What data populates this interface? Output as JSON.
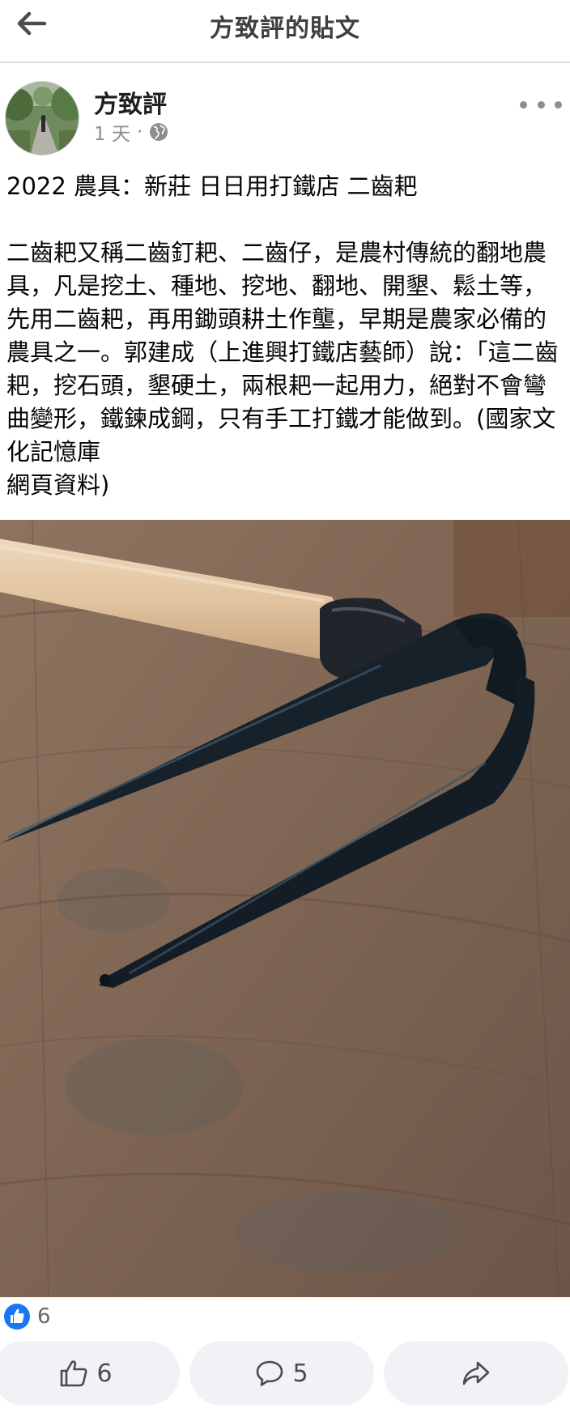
{
  "header": {
    "title": "方致評的貼文",
    "back_icon": "arrow-left-icon"
  },
  "post": {
    "author": "方致評",
    "time": "1 天",
    "separator": "·",
    "privacy_icon": "globe-icon",
    "title_line": "2022 農具：新莊 日日用打鐵店 二齒耙",
    "body": "二齒耙又稱二齒釘耙、二齒仔，是農村傳統的翻地農具，凡是挖土、種地、挖地、翻地、開墾、鬆土等，先用二齒耙，再用鋤頭耕土作壟，早期是農家必備的農具之一。郭建成（上進興打鐵店藝師）說：「這二齒耙，挖石頭，墾硬土，兩根耙一起用力，絕對不會彎曲變形，鐵鍊成鋼，只有手工打鐵才能做到。(國家文化記憶庫\n網頁資料)"
  },
  "reactions": {
    "count": "6",
    "icon": "like-reaction-icon"
  },
  "actions": {
    "like_count": "6",
    "comment_count": "5"
  },
  "colors": {
    "accent": "#1877f2",
    "button_bg": "#f0f2f5",
    "secondary_text": "#8a8d91"
  }
}
